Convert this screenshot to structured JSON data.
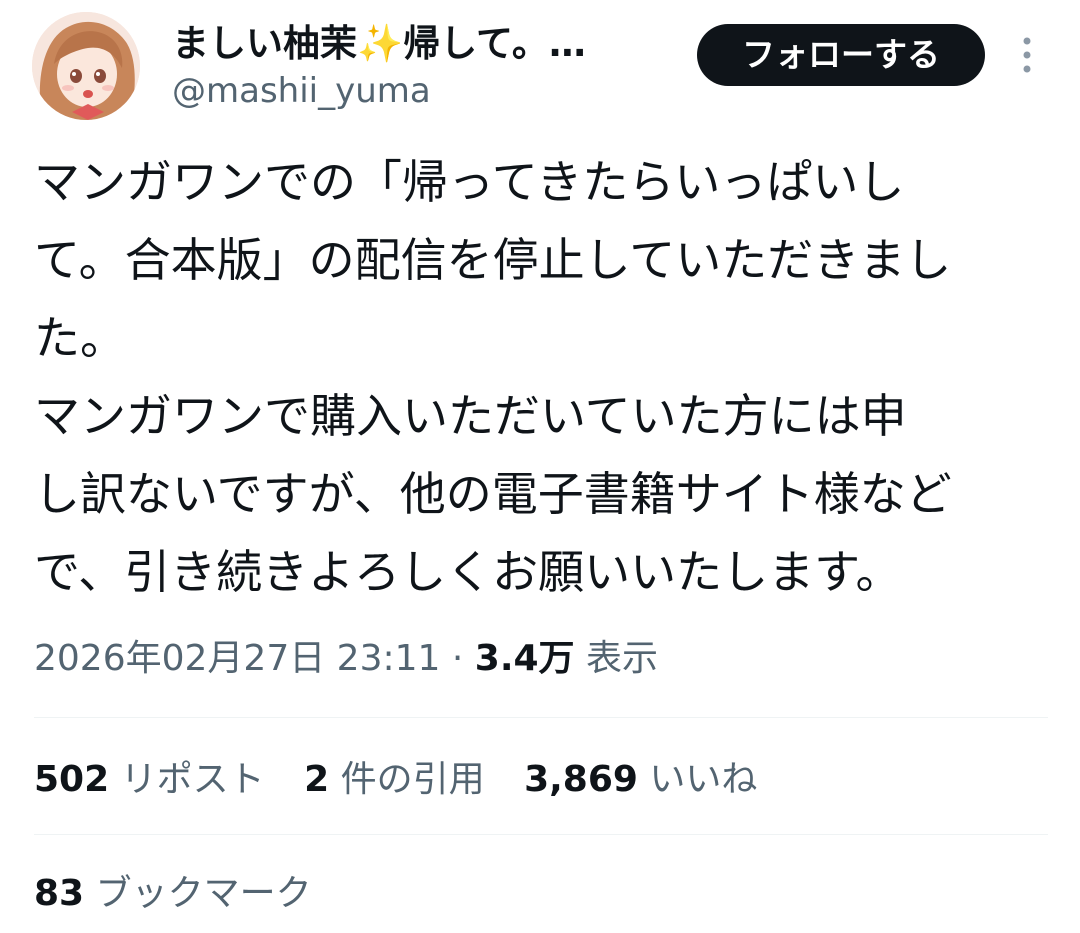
{
  "user": {
    "display_name": "ましい柚茉✨帰して。…",
    "handle": "@mashii_yuma",
    "follow_label": "フォローする"
  },
  "tweet": {
    "lines": [
      "マンガワンでの「帰ってきたらいっぱいし",
      "て。合本版」の配信を停止していただきまし",
      "た。",
      "マンガワンで購入いただいていた方には申",
      "し訳ないですが、他の電子書籍サイト様など",
      "で、引き続きよろしくお願いいたします。"
    ]
  },
  "meta": {
    "timestamp": "2026年02月27日 23:11",
    "separator": " · ",
    "views_count": "3.4万",
    "views_label": "表示"
  },
  "stats": {
    "reposts_count": "502",
    "reposts_label": "リポスト",
    "quotes_count": "2",
    "quotes_label": "件の引用",
    "likes_count": "3,869",
    "likes_label": "いいね",
    "bookmarks_count": "83",
    "bookmarks_label": "ブックマーク"
  },
  "icons": {
    "more": "more-vertical-icon"
  },
  "colors": {
    "text_primary": "#0f1419",
    "text_secondary": "#536471",
    "button_bg": "#0f1419",
    "divider": "#eff3f4"
  }
}
